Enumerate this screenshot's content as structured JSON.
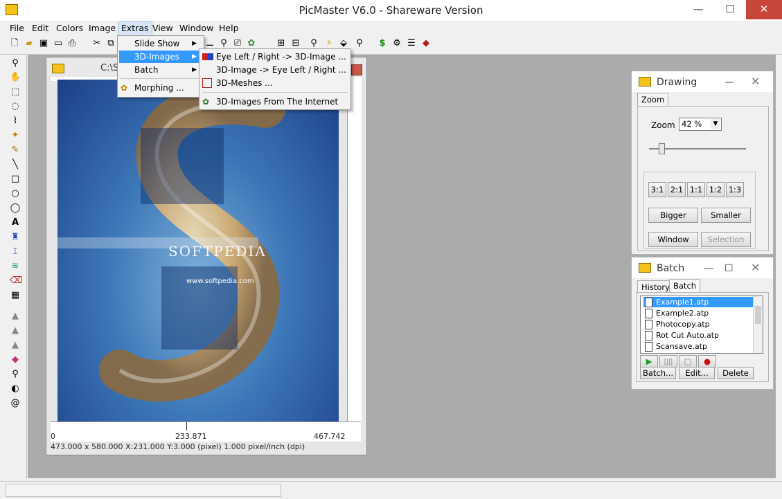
{
  "app": {
    "title": "PicMaster V6.0 - Shareware Version"
  },
  "window_controls": {
    "minimize": "—",
    "maximize": "☐",
    "close": "✕"
  },
  "menubar": [
    "File",
    "Edit",
    "Colors",
    "Image",
    "Extras",
    "View",
    "Window",
    "Help"
  ],
  "extras_menu": {
    "items": [
      {
        "label": "Slide Show",
        "submenu": true
      },
      {
        "label": "3D-Images",
        "submenu": true,
        "highlighted": true
      },
      {
        "label": "Batch",
        "submenu": true
      },
      {
        "label": "Morphing ...",
        "submenu": false
      }
    ]
  },
  "threed_submenu": {
    "items": [
      "Eye Left / Right -> 3D-Image ...",
      "3D-Image -> Eye Left / Right ...",
      "3D-Meshes ...",
      "3D-Images From The Internet"
    ]
  },
  "image_window": {
    "title": "C:\\S",
    "ruler": {
      "left": "0",
      "mid": "233.871",
      "right": "467.742"
    },
    "status": "473.000 x 580.000    X:231.000  Y:3.000 (pixel)  1.000 pixel/inch (dpi)",
    "watermark": "SOFTPEDIA",
    "url": "www.softpedia.com"
  },
  "drawing_panel": {
    "title": "Drawing",
    "tab": "Zoom",
    "zoom_label": "Zoom",
    "zoom_value": "42 %",
    "ratio_buttons": [
      "3:1",
      "2:1",
      "1:1",
      "1:2",
      "1:3"
    ],
    "bigger": "Bigger",
    "smaller": "Smaller",
    "window": "Window",
    "selection": "Selection"
  },
  "batch_panel": {
    "title": "Batch",
    "tabs": [
      "History",
      "Batch"
    ],
    "files": [
      "Example1.atp",
      "Example2.atp",
      "Photocopy.atp",
      "Rot Cut Auto.atp",
      "Scansave.atp"
    ],
    "selected_index": 0,
    "buttons": [
      "Batch...",
      "Edit...",
      "Delete"
    ]
  },
  "colors": {
    "menu_highlight": "#3399ff",
    "mdi_background": "#ababab",
    "close_button": "#c7463a"
  }
}
